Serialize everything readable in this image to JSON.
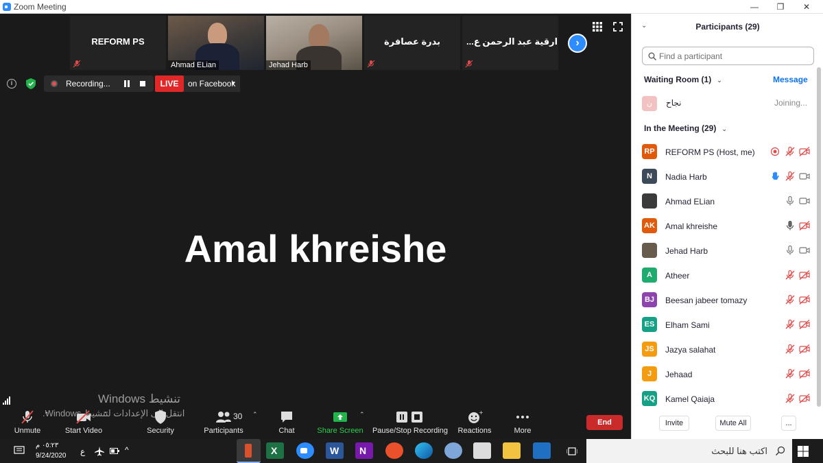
{
  "window": {
    "title": "Zoom Meeting",
    "minimize": "—",
    "restore": "❐",
    "close": "✕"
  },
  "thumbnails": [
    {
      "name": "REFORM PS",
      "type": "name"
    },
    {
      "name": "Ahmad ELian",
      "type": "video"
    },
    {
      "name": "Jehad Harb",
      "type": "video"
    },
    {
      "name": "بدرة عصافرة",
      "type": "name"
    },
    {
      "name": "...ارقية عبد الرحمن ع",
      "type": "name"
    }
  ],
  "status": {
    "recording": "Recording...",
    "live": "LIVE",
    "live_target": "on Facebook"
  },
  "active_speaker": "Amal khreishe",
  "watermark": {
    "line1": "Windows تنشيط",
    "line2": "انتقل إلى الإعدادات لتنشيط Windows."
  },
  "toolbar": {
    "unmute": "Unmute",
    "start_video": "Start Video",
    "security": "Security",
    "participants": "Participants",
    "participants_count": "30",
    "chat": "Chat",
    "share_screen": "Share Screen",
    "pause_stop": "Pause/Stop Recording",
    "reactions": "Reactions",
    "more": "More",
    "end": "End"
  },
  "panel": {
    "title": "Participants (29)",
    "search_placeholder": "Find a participant",
    "waiting_title": "Waiting Room (1)",
    "message": "Message",
    "waiting": [
      {
        "initial": "ن",
        "name": "نجاح",
        "status": "Joining..."
      }
    ],
    "meeting_title": "In the Meeting (29)",
    "participants": [
      {
        "initials": "RP",
        "name": "REFORM PS (Host, me)",
        "color": "#e05a0c",
        "recording": true,
        "hand": false,
        "mic": "off",
        "video": "off"
      },
      {
        "initials": "N",
        "name": "Nadia Harb",
        "color": "#3c4a5a",
        "recording": false,
        "hand": true,
        "mic": "off",
        "video": "on"
      },
      {
        "initials": "",
        "name": "Ahmad ELian",
        "color": "#3b3b3b",
        "recording": false,
        "hand": false,
        "mic": "on",
        "video": "on"
      },
      {
        "initials": "AK",
        "name": "Amal khreishe",
        "color": "#e05a0c",
        "recording": false,
        "hand": false,
        "mic": "active",
        "video": "off"
      },
      {
        "initials": "",
        "name": "Jehad Harb",
        "color": "#6a5c4c",
        "recording": false,
        "hand": false,
        "mic": "on",
        "video": "on"
      },
      {
        "initials": "A",
        "name": "Atheer",
        "color": "#1faa6e",
        "recording": false,
        "hand": false,
        "mic": "off",
        "video": "off"
      },
      {
        "initials": "BJ",
        "name": "Beesan jabeer tomazy",
        "color": "#8e44ad",
        "recording": false,
        "hand": false,
        "mic": "off",
        "video": "off"
      },
      {
        "initials": "ES",
        "name": "Elham Sami",
        "color": "#16a085",
        "recording": false,
        "hand": false,
        "mic": "off",
        "video": "off"
      },
      {
        "initials": "JS",
        "name": "Jazya salahat",
        "color": "#f39c12",
        "recording": false,
        "hand": false,
        "mic": "off",
        "video": "off"
      },
      {
        "initials": "J",
        "name": "Jehaad",
        "color": "#f39c12",
        "recording": false,
        "hand": false,
        "mic": "off",
        "video": "off"
      },
      {
        "initials": "KQ",
        "name": "Kamel Qaiaja",
        "color": "#16a085",
        "recording": false,
        "hand": false,
        "mic": "off",
        "video": "off"
      }
    ],
    "invite": "Invite",
    "mute_all": "Mute All",
    "more": "..."
  },
  "taskbar": {
    "time": "٠٥:٢٣ م",
    "date": "9/24/2020",
    "lang": "ع",
    "search": "اكتب هنا للبحث"
  }
}
